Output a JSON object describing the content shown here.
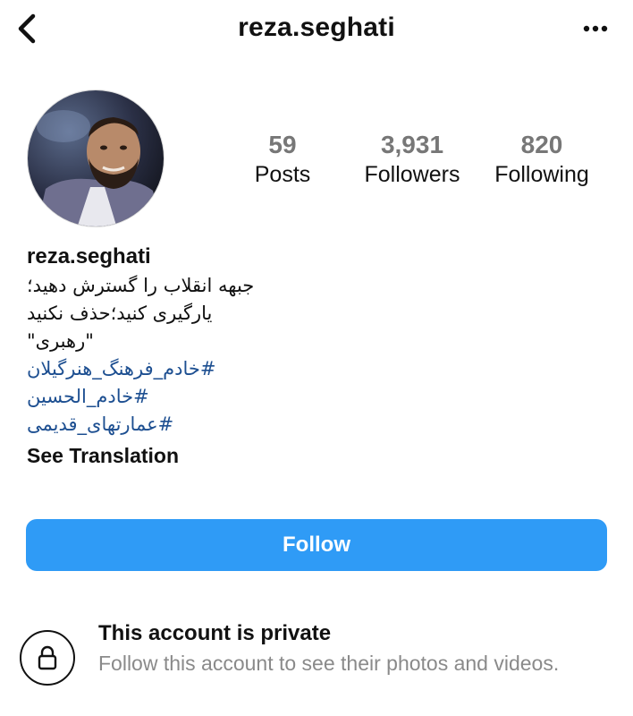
{
  "header": {
    "title": "reza.seghati",
    "back_icon": "chevron-left-icon",
    "more_icon": "more-horizontal-icon"
  },
  "profile": {
    "avatar_icon": "profile-photo",
    "stats": [
      {
        "value": "59",
        "label": "Posts"
      },
      {
        "value": "3,931",
        "label": "Followers"
      },
      {
        "value": "820",
        "label": "Following"
      }
    ]
  },
  "bio": {
    "username": "reza.seghati",
    "lines": [
      "جبهه انقلاب را گسترش دهید؛",
      "یارگیری کنید؛حذف نکنید",
      "\"رهبری\""
    ],
    "hashtags": [
      "#خادم_فرهنگ_هنرگیلان",
      "#خادم_الحسین",
      "#عمارتهای_قدیمی"
    ],
    "see_translation": "See Translation"
  },
  "actions": {
    "follow_label": "Follow",
    "follow_color": "#2f9bf6"
  },
  "private_notice": {
    "icon": "lock-icon",
    "title": "This account is private",
    "subtitle": "Follow this account to see their photos and videos."
  },
  "colors": {
    "hashtag": "#1d4f91",
    "stat_number": "#777777",
    "muted_text": "#8a8a8a"
  }
}
